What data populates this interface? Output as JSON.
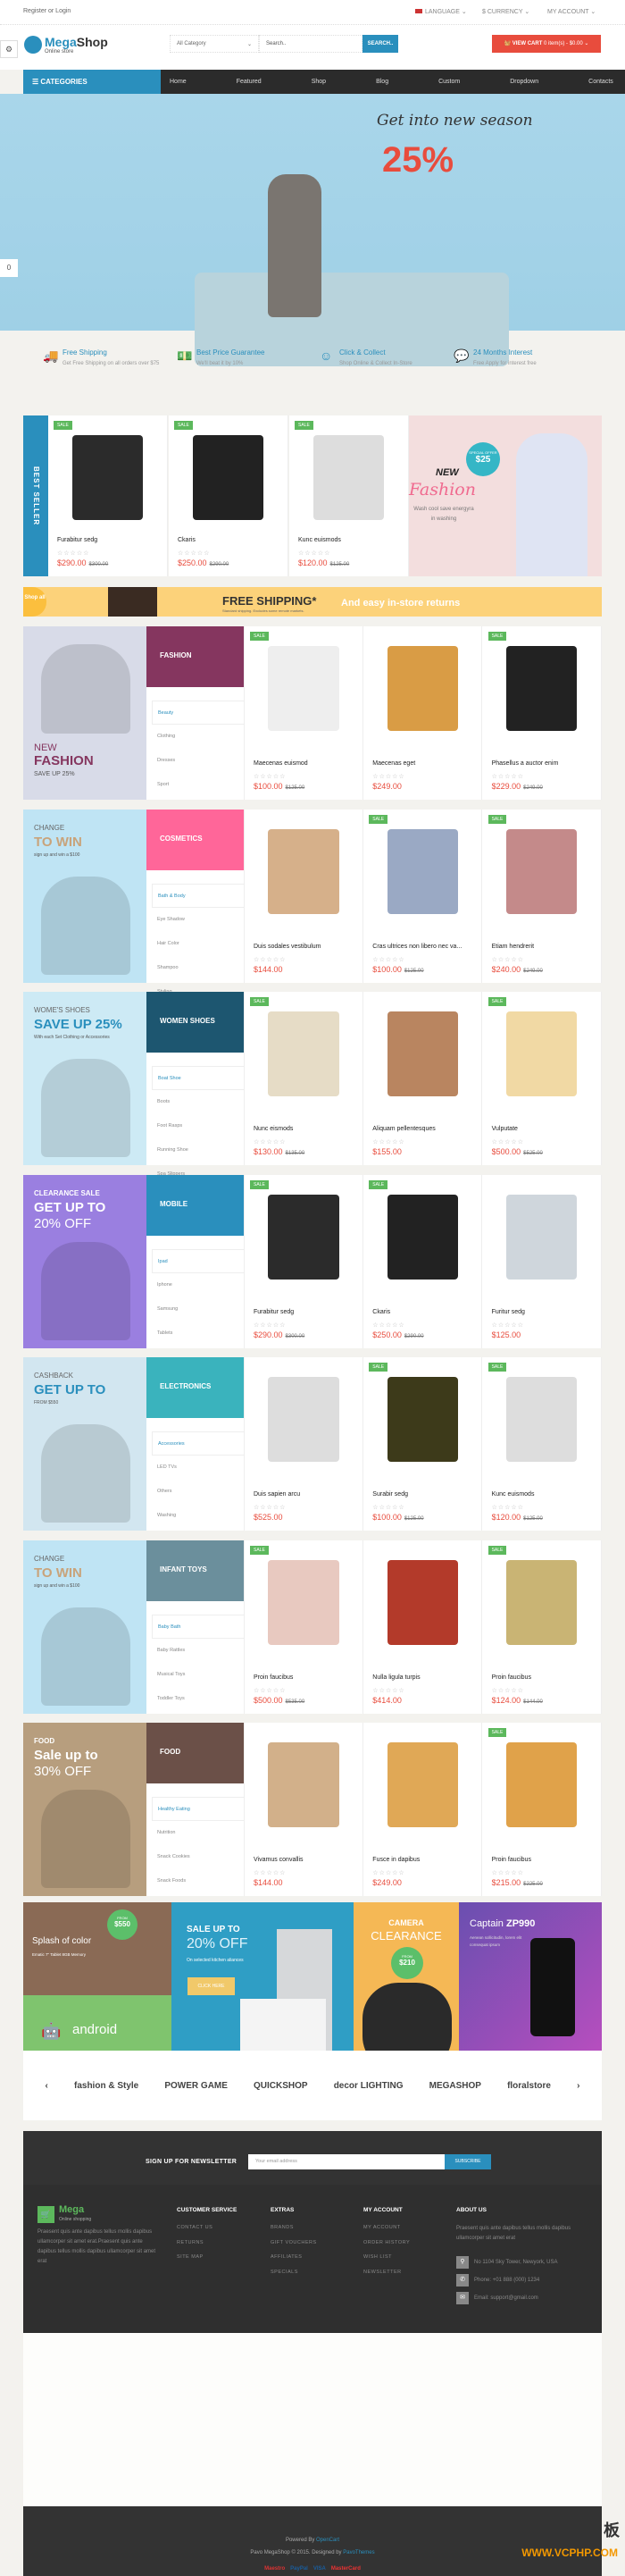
{
  "topbar": {
    "login": "Register or Login",
    "language": "Language",
    "currency": "$ Currency",
    "account": "My Account"
  },
  "header": {
    "logo_main": "Mega",
    "logo_bold": "Shop",
    "logo_sub": "Online store",
    "category_select": "All Category",
    "search_placeholder": "Search..",
    "search_button": "SEARCH..",
    "cart_label": "VIEW CART",
    "cart_info": "0 item(s) - $0.00"
  },
  "nav": {
    "categories": "CATEGORIES",
    "items": [
      "Home",
      "Featured",
      "Shop",
      "Blog",
      "Custom",
      "Dropdown",
      "Contacts us"
    ]
  },
  "hero": {
    "tagline": "Get into new season",
    "percent": "25%"
  },
  "features": [
    {
      "icon": "truck-icon",
      "title": "Free Shipping",
      "desc": "Get Free Shipping on all orders over $75"
    },
    {
      "icon": "money-icon",
      "title": "Best Price Guarantee",
      "desc": "We'll beat it by 10%"
    },
    {
      "icon": "smiley-icon",
      "title": "Click & Collect",
      "desc": "Shop Online & Collect In-Store"
    },
    {
      "icon": "chat-icon",
      "title": "24 Months Interest",
      "desc": "Free Apply for interest free"
    }
  ],
  "sale_label": "SALE",
  "stars": "☆☆☆☆☆",
  "best_seller": {
    "label": "BEST SELLER",
    "products": [
      {
        "name": "Furabitur sedg",
        "price": "$290.00",
        "old": "$300.00",
        "sale": true,
        "color": "#2b2b2b"
      },
      {
        "name": "Ckaris",
        "price": "$250.00",
        "old": "$290.00",
        "sale": true,
        "color": "#222"
      },
      {
        "name": "Kunc euismods",
        "price": "$120.00",
        "old": "$125.00",
        "sale": true,
        "color": "#ddd"
      }
    ],
    "banner": {
      "new": "NEW",
      "fashion": "Fashion",
      "desc": "Wash cool save energyra in washing",
      "offer": "SPECIAL OFFER",
      "offer_price": "$25"
    }
  },
  "shipping_bar": {
    "shop": "Shop all",
    "title": "FREE SHIPPING*",
    "sub": "Standard shipping. Excludes some remote markets.",
    "returns": "And easy in-store returns"
  },
  "sections": [
    {
      "title": "FASHION",
      "color": "#85365f",
      "banner_bg": "#d8dbe8",
      "banner": [
        "NEW",
        "FASHION",
        "SAVE UP 25%"
      ],
      "menu": [
        "Beauty",
        "Clothing",
        "Dresses",
        "Sport"
      ],
      "products": [
        {
          "name": "Maecenas euismod",
          "price": "$100.00",
          "old": "$125.00",
          "sale": true,
          "color": "#eee"
        },
        {
          "name": "Maecenas eget",
          "price": "$249.00",
          "old": "",
          "sale": false,
          "color": "#d99c45"
        },
        {
          "name": "Phasellus a auctor enim",
          "price": "$229.00",
          "old": "$249.00",
          "sale": true,
          "color": "#222"
        }
      ]
    },
    {
      "title": "COSMETICS",
      "color": "#ff6699",
      "banner_bg": "#bfe4f4",
      "banner": [
        "CHANGE",
        "TO WIN",
        "sign up and win a $100"
      ],
      "menu": [
        "Bath & Body",
        "Eye Shadow",
        "Hair Color",
        "Shampoo",
        "Styling"
      ],
      "products": [
        {
          "name": "Duis sodales vestibulum",
          "price": "$144.00",
          "old": "",
          "sale": false,
          "color": "#d6b08a"
        },
        {
          "name": "Cras ultrices non libero nec va...",
          "price": "$100.00",
          "old": "$125.00",
          "sale": true,
          "color": "#9aa9c4"
        },
        {
          "name": "Etiam hendrerit",
          "price": "$240.00",
          "old": "$249.00",
          "sale": true,
          "color": "#c48a8a"
        }
      ]
    },
    {
      "title": "WOMEN SHOES",
      "color": "#1d5670",
      "banner_bg": "#cdeaf5",
      "banner": [
        "WOME'S SHOES",
        "SAVE UP 25%",
        "With each Set Clothing or Accessories"
      ],
      "menu": [
        "Boat Shoe",
        "Boots",
        "Foot Rasps",
        "Running Shoe",
        "Spa Slippers"
      ],
      "products": [
        {
          "name": "Nunc eismods",
          "price": "$130.00",
          "old": "$135.00",
          "sale": true,
          "color": "#e6dcc6"
        },
        {
          "name": "Aliquam pellentesques",
          "price": "$155.00",
          "old": "",
          "sale": false,
          "color": "#b98560"
        },
        {
          "name": "Vulputate",
          "price": "$500.00",
          "old": "$525.00",
          "sale": true,
          "color": "#f1d9a4"
        }
      ]
    },
    {
      "title": "MOBILE",
      "color": "#2a8fbd",
      "banner_bg": "#9a7fe0",
      "banner": [
        "CLEARANCE SALE",
        "GET UP TO",
        "20% OFF"
      ],
      "menu": [
        "Ipad",
        "Iphone",
        "Samsung",
        "Tablets"
      ],
      "products": [
        {
          "name": "Furabitur sedg",
          "price": "$290.00",
          "old": "$300.00",
          "sale": true,
          "color": "#2b2b2b"
        },
        {
          "name": "Ckaris",
          "price": "$250.00",
          "old": "$290.00",
          "sale": true,
          "color": "#222"
        },
        {
          "name": "Furitur sedg",
          "price": "$125.00",
          "old": "",
          "sale": false,
          "color": "#cfd6dc"
        }
      ]
    },
    {
      "title": "ELECTRONICS",
      "color": "#3ab3bd",
      "banner_bg": "#d2e6f0",
      "banner": [
        "CASHBACK",
        "GET UP TO",
        "FROM $550"
      ],
      "menu": [
        "Accessories",
        "LED TVs",
        "Others",
        "Washing"
      ],
      "products": [
        {
          "name": "Duis sapien arcu",
          "price": "$525.00",
          "old": "",
          "sale": false,
          "color": "#ddd"
        },
        {
          "name": "Surabir sedg",
          "price": "$100.00",
          "old": "$125.00",
          "sale": true,
          "color": "#3d3a1a"
        },
        {
          "name": "Kunc euismods",
          "price": "$120.00",
          "old": "$125.00",
          "sale": true,
          "color": "#ddd"
        }
      ]
    },
    {
      "title": "INFANT TOYS",
      "color": "#6b8f9c",
      "banner_bg": "#bfe4f4",
      "banner": [
        "CHANGE",
        "TO WIN",
        "sign up and win a $100"
      ],
      "menu": [
        "Baby Bath",
        "Baby Rattles",
        "Musical Toys",
        "Toddler Toys"
      ],
      "products": [
        {
          "name": "Proin faucibus",
          "price": "$500.00",
          "old": "$535.00",
          "sale": true,
          "color": "#e8c9c0"
        },
        {
          "name": "Nulla ligula turpis",
          "price": "$414.00",
          "old": "",
          "sale": false,
          "color": "#b33a2a"
        },
        {
          "name": "Proin faucibus",
          "price": "$124.00",
          "old": "$144.00",
          "sale": true,
          "color": "#c9b474"
        }
      ]
    },
    {
      "title": "FOOD",
      "color": "#6b5048",
      "banner_bg": "#b79e7e",
      "banner": [
        "FOOD",
        "Sale up to",
        "30% OFF"
      ],
      "menu": [
        "Healthy Eating",
        "Nutrition",
        "Snack Cookies",
        "Snack Foods"
      ],
      "products": [
        {
          "name": "Vivamus convallis",
          "price": "$144.00",
          "old": "",
          "sale": false,
          "color": "#d2b08a"
        },
        {
          "name": "Fusce in dapibus",
          "price": "$249.00",
          "old": "",
          "sale": false,
          "color": "#e0a856"
        },
        {
          "name": "Proin faucibus",
          "price": "$215.00",
          "old": "$225.00",
          "sale": true,
          "color": "#e0a24a"
        }
      ]
    }
  ],
  "promos": {
    "splash": {
      "title": "Splash of color",
      "sub": "Ematic 7\" Tablet 8GB Memory",
      "from": "FROM",
      "price": "$550"
    },
    "android": {
      "title": "android",
      "sub": "top selling products of the month"
    },
    "sale": {
      "title": "SALE UP TO",
      "big": "20% OFF",
      "sub": "On selected kitchen aliances",
      "button": "CLICK HERE"
    },
    "camera": {
      "title": "CAMERA",
      "big": "CLEARANCE",
      "from": "FROM",
      "price": "$210"
    },
    "captain": {
      "title": "Captain",
      "bold": "ZP990",
      "sub": "Aenean sollicitudin, lorem elit consequat ipsum"
    }
  },
  "brands": [
    "fashion & Style",
    "POWER GAME",
    "QUICKSHOP",
    "decor LIGHTING",
    "MEGASHOP",
    "floralstore"
  ],
  "newsletter": {
    "title": "SIGN UP FOR NEWSLETTER",
    "placeholder": "Your email address",
    "button": "SUBSCRIBE"
  },
  "footer": {
    "logo": "Mega",
    "logo_sub": "Online shopping",
    "about_text": "Praesent quis ante dapibus tellus mollis dapibus ullamcorper sit amet erat.Praesent quis ante dapibus tellus mollis dapibus ullamcorper sit amet erat",
    "columns": [
      {
        "title": "CUSTOMER SERVICE",
        "links": [
          "CONTACT US",
          "RETURNS",
          "SITE MAP"
        ]
      },
      {
        "title": "EXTRAS",
        "links": [
          "BRANDS",
          "GIFT VOUCHERS",
          "AFFILIATES",
          "SPECIALS"
        ]
      },
      {
        "title": "MY ACCOUNT",
        "links": [
          "MY ACCOUNT",
          "ORDER HISTORY",
          "WISH LIST",
          "NEWSLETTER"
        ]
      }
    ],
    "about_title": "ABOUT US",
    "about_us": "Praesent quis ante dapibus tellus mollis dapibus ullamcorper sit amet erat",
    "address": "No 1104 Sky Tower, Newyork, USA",
    "phone": "Phone: +01 888 (000) 1234",
    "email": "Email: support@gmail.com"
  },
  "bottom": {
    "powered": "Powered By",
    "opencart": "OpenCart",
    "copyright": "Pavo MegaShop © 2015. Designed by",
    "designer": "PavoThemes",
    "payments": [
      "Maestro",
      "PayPal",
      "VISA",
      "MasterCard"
    ]
  },
  "watermark": {
    "char": "板",
    "site": "WWW.VCPHP.COM"
  },
  "colors": {
    "accent": "#2a8fbd",
    "price": "#e84c3d",
    "sale": "#5cb85c",
    "cart": "#e84c3d"
  }
}
